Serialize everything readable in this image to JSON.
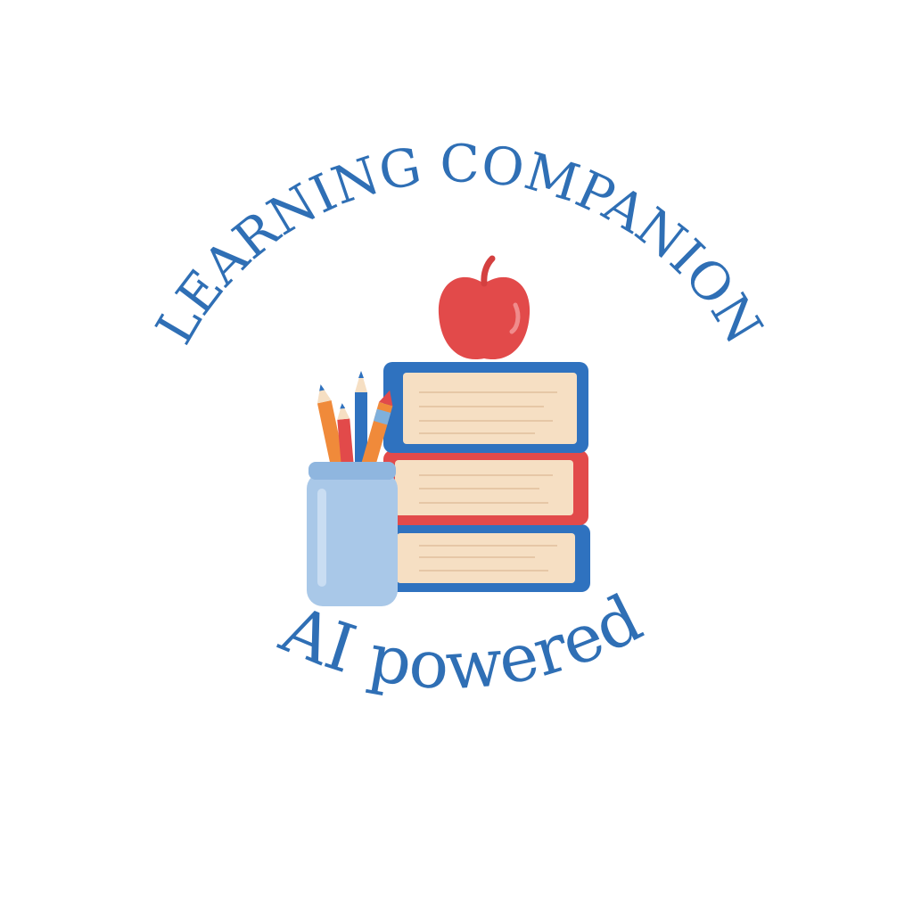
{
  "logo": {
    "top_text": "LEARNING  COMPANION",
    "bottom_text": "AI powered"
  },
  "colors": {
    "text_blue": "#2f6fb5",
    "book_blue": "#2f72bf",
    "book_red": "#e24a4a",
    "page_cream": "#f6dfc3",
    "jar_blue": "#a9c8e8",
    "apple_red": "#e24a4a",
    "pencil_orange": "#f08a3a"
  },
  "icons": [
    "apple-icon",
    "book-stack-icon",
    "pencil-jar-icon"
  ]
}
